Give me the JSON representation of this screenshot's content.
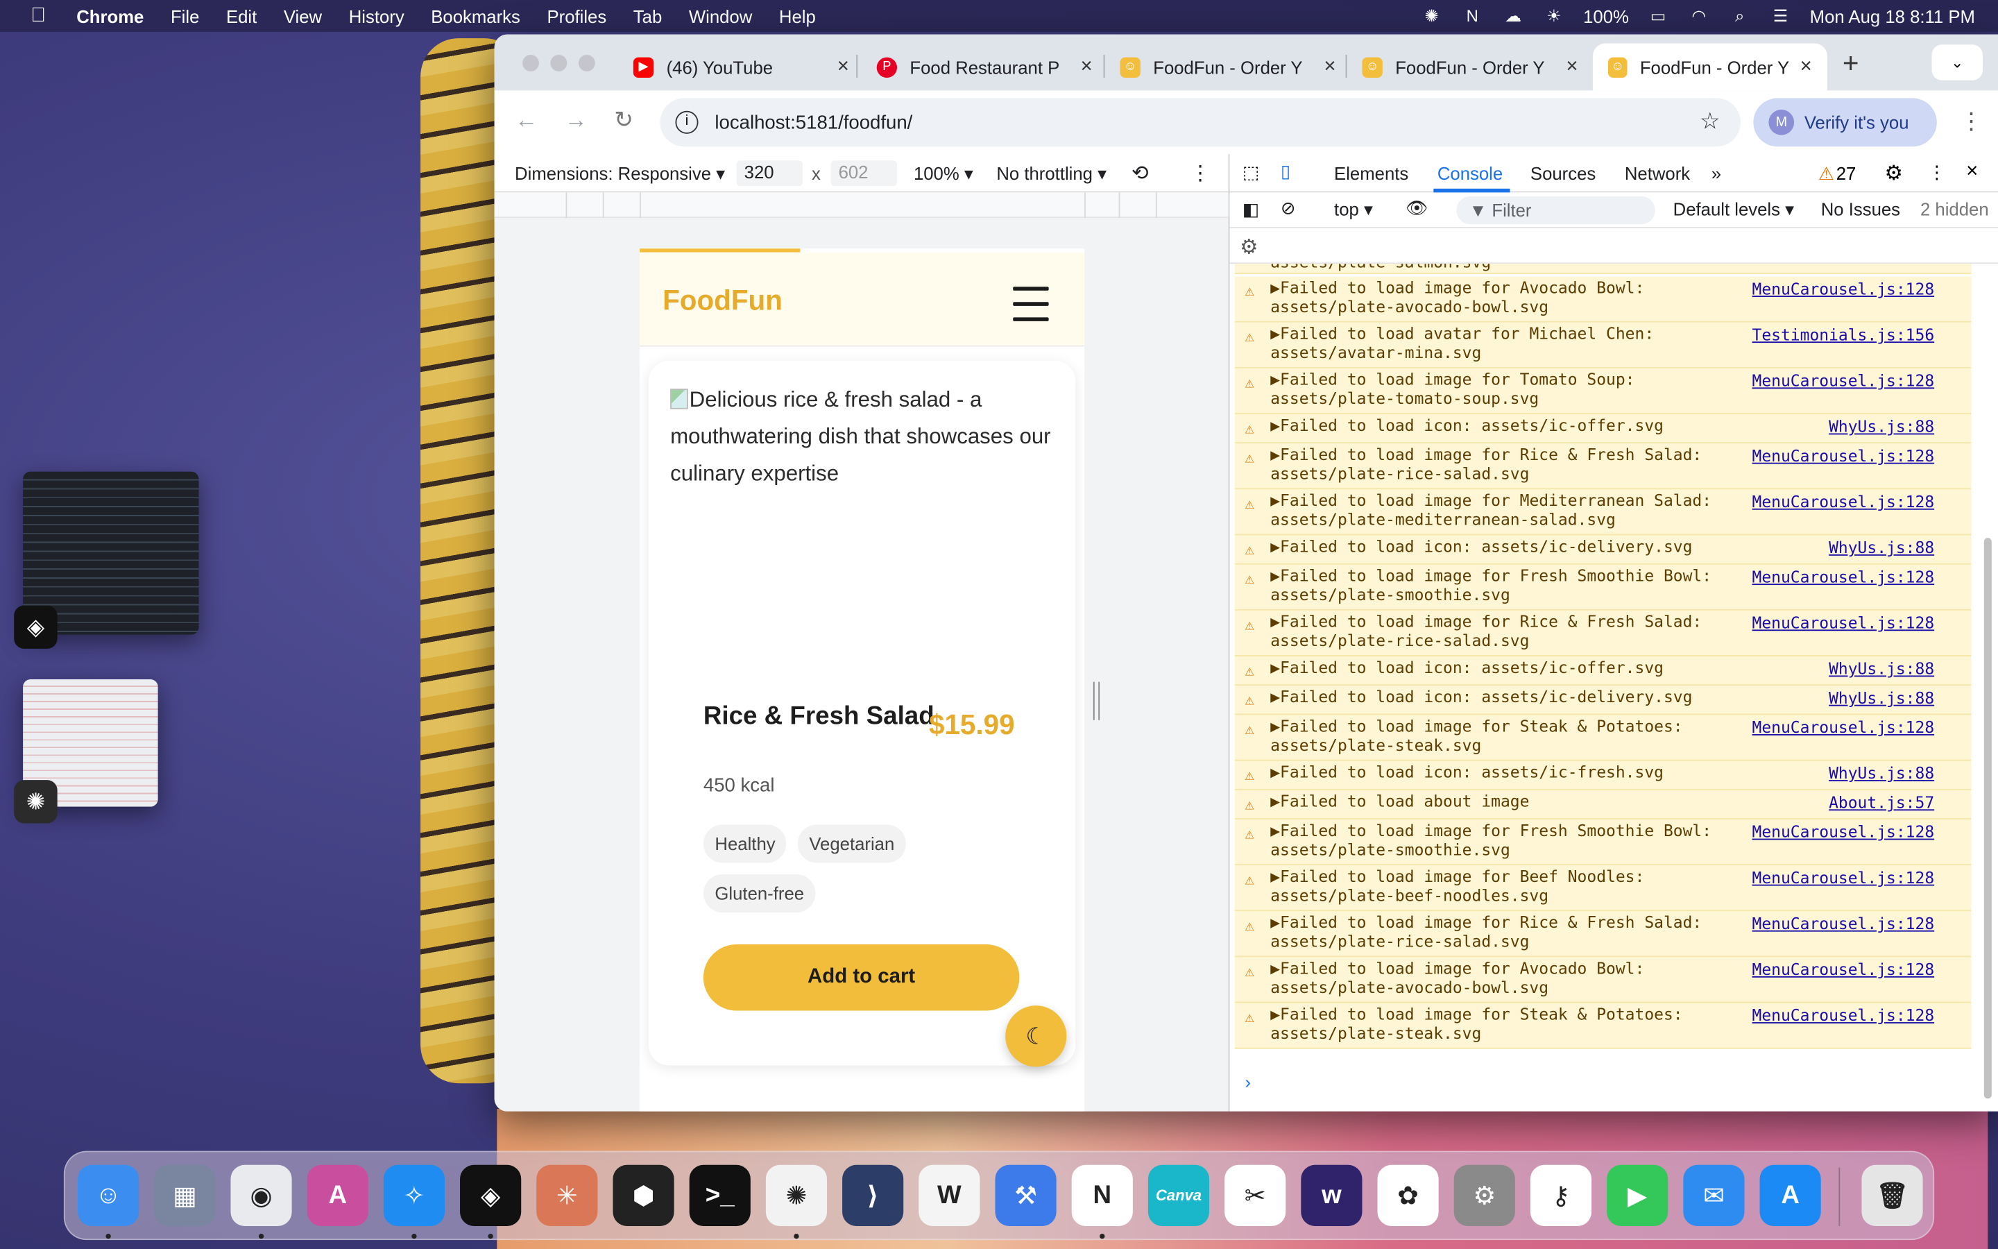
{
  "menubar": {
    "app_name": "Chrome",
    "items": [
      "File",
      "Edit",
      "View",
      "History",
      "Bookmarks",
      "Profiles",
      "Tab",
      "Window",
      "Help"
    ],
    "battery": "100%",
    "datetime": "Mon Aug 18  8:11 PM"
  },
  "browser": {
    "tabs": [
      {
        "title": "(46) YouTube",
        "icon": "youtube-icon",
        "color": "#ff0000"
      },
      {
        "title": "Food Restaurant P",
        "icon": "pinterest-icon",
        "color": "#e60023"
      },
      {
        "title": "FoodFun - Order Y",
        "icon": "foodfun-favicon",
        "color": "#e6ab2a"
      },
      {
        "title": "FoodFun - Order Y",
        "icon": "foodfun-favicon",
        "color": "#e6ab2a"
      },
      {
        "title": "FoodFun - Order Y",
        "icon": "foodfun-favicon",
        "color": "#e6ab2a",
        "active": true
      }
    ],
    "url": "localhost:5181/foodfun/",
    "profile_button": "Verify it's you",
    "profile_initial": "M"
  },
  "device_toolbar": {
    "dimensions_label": "Dimensions: Responsive",
    "width": "320",
    "times": "x",
    "height_placeholder": "602",
    "zoom": "100%",
    "throttling": "No throttling"
  },
  "site": {
    "logo": "FoodFun",
    "dish": {
      "image_alt": "Delicious rice & fresh salad - a mouthwatering dish that showcases our culinary expertise",
      "name": "Rice & Fresh Salad",
      "price": "$15.99",
      "kcal": "450 kcal",
      "tags": [
        "Healthy",
        "Vegetarian",
        "Gluten-free"
      ],
      "cta": "Add to cart"
    }
  },
  "devtools": {
    "tabs": [
      "Elements",
      "Console",
      "Sources",
      "Network"
    ],
    "active_tab": "Console",
    "warning_count": "27",
    "context": "top",
    "filter_placeholder": "Filter",
    "levels": "Default levels",
    "issues": "No Issues",
    "hidden": "2 hidden",
    "clipped_line": "assets/plate-salmon.svg",
    "logs": [
      {
        "msg": "Failed to load image for Avocado Bowl:\nassets/plate-avocado-bowl.svg",
        "src": "MenuCarousel.js:128"
      },
      {
        "msg": "Failed to load avatar for Michael Chen:\nassets/avatar-mina.svg",
        "src": "Testimonials.js:156"
      },
      {
        "msg": "Failed to load image for Tomato Soup:\nassets/plate-tomato-soup.svg",
        "src": "MenuCarousel.js:128"
      },
      {
        "msg": "Failed to load icon: assets/ic-offer.svg",
        "src": "WhyUs.js:88"
      },
      {
        "msg": "Failed to load image for Rice & Fresh Salad:\nassets/plate-rice-salad.svg",
        "src": "MenuCarousel.js:128"
      },
      {
        "msg": "Failed to load image for Mediterranean Salad:\nassets/plate-mediterranean-salad.svg",
        "src": "MenuCarousel.js:128"
      },
      {
        "msg": "Failed to load icon: assets/ic-delivery.svg",
        "src": "WhyUs.js:88"
      },
      {
        "msg": "Failed to load image for Fresh Smoothie Bowl:\nassets/plate-smoothie.svg",
        "src": "MenuCarousel.js:128"
      },
      {
        "msg": "Failed to load image for Rice & Fresh Salad:\nassets/plate-rice-salad.svg",
        "src": "MenuCarousel.js:128"
      },
      {
        "msg": "Failed to load icon: assets/ic-offer.svg",
        "src": "WhyUs.js:88"
      },
      {
        "msg": "Failed to load icon: assets/ic-delivery.svg",
        "src": "WhyUs.js:88"
      },
      {
        "msg": "Failed to load image for Steak & Potatoes:\nassets/plate-steak.svg",
        "src": "MenuCarousel.js:128"
      },
      {
        "msg": "Failed to load icon: assets/ic-fresh.svg",
        "src": "WhyUs.js:88"
      },
      {
        "msg": "Failed to load about image",
        "src": "About.js:57"
      },
      {
        "msg": "Failed to load image for Fresh Smoothie Bowl:\nassets/plate-smoothie.svg",
        "src": "MenuCarousel.js:128"
      },
      {
        "msg": "Failed to load image for Beef Noodles:\nassets/plate-beef-noodles.svg",
        "src": "MenuCarousel.js:128"
      },
      {
        "msg": "Failed to load image for Rice & Fresh Salad:\nassets/plate-rice-salad.svg",
        "src": "MenuCarousel.js:128"
      },
      {
        "msg": "Failed to load image for Avocado Bowl:\nassets/plate-avocado-bowl.svg",
        "src": "MenuCarousel.js:128"
      },
      {
        "msg": "Failed to load image for Steak & Potatoes:\nassets/plate-steak.svg",
        "src": "MenuCarousel.js:128"
      }
    ]
  },
  "dock": {
    "apps": [
      {
        "icon": "finder-icon",
        "color": "#3b8ef0",
        "running": true
      },
      {
        "icon": "launchpad-icon",
        "color": "#7a86a0",
        "running": false
      },
      {
        "icon": "chrome-icon",
        "color": "#e8eaed",
        "running": true
      },
      {
        "icon": "affinity-icon",
        "color": "#c94f9e",
        "running": false
      },
      {
        "icon": "safari-icon",
        "color": "#1e8cf0",
        "running": true
      },
      {
        "icon": "cursor-app-icon",
        "color": "#111111",
        "running": true
      },
      {
        "icon": "claude-icon",
        "color": "#d97757",
        "running": false
      },
      {
        "icon": "cube-app-icon",
        "color": "#222222",
        "running": false
      },
      {
        "icon": "terminal-icon",
        "color": "#111111",
        "running": false
      },
      {
        "icon": "chatgpt-icon",
        "color": "#f2f2f2",
        "running": true
      },
      {
        "icon": "code-app-icon",
        "color": "#2c3e67",
        "running": false
      },
      {
        "icon": "writing-app-icon",
        "color": "#f4f4f4",
        "running": false
      },
      {
        "icon": "xcode-icon",
        "color": "#3d7bea",
        "running": false
      },
      {
        "icon": "notion-icon",
        "color": "#ffffff",
        "running": true
      },
      {
        "icon": "canva-icon",
        "color": "#19b7c9",
        "running": false
      },
      {
        "icon": "capcut-icon",
        "color": "#ffffff",
        "running": false
      },
      {
        "icon": "w-app-icon",
        "color": "#30226b",
        "running": false
      },
      {
        "icon": "photos-icon",
        "color": "#ffffff",
        "running": false
      },
      {
        "icon": "system-settings-icon",
        "color": "#8a8a8a",
        "running": false
      },
      {
        "icon": "keychain-icon",
        "color": "#ffffff",
        "running": false
      },
      {
        "icon": "facetime-icon",
        "color": "#34c759",
        "running": false
      },
      {
        "icon": "mail-icon",
        "color": "#2e8cf0",
        "running": false
      },
      {
        "icon": "app-store-icon",
        "color": "#1b8af5",
        "running": false
      },
      {
        "icon": "trash-icon",
        "color": "#e5e5e5",
        "running": false
      }
    ],
    "canva_label": "Canva"
  }
}
